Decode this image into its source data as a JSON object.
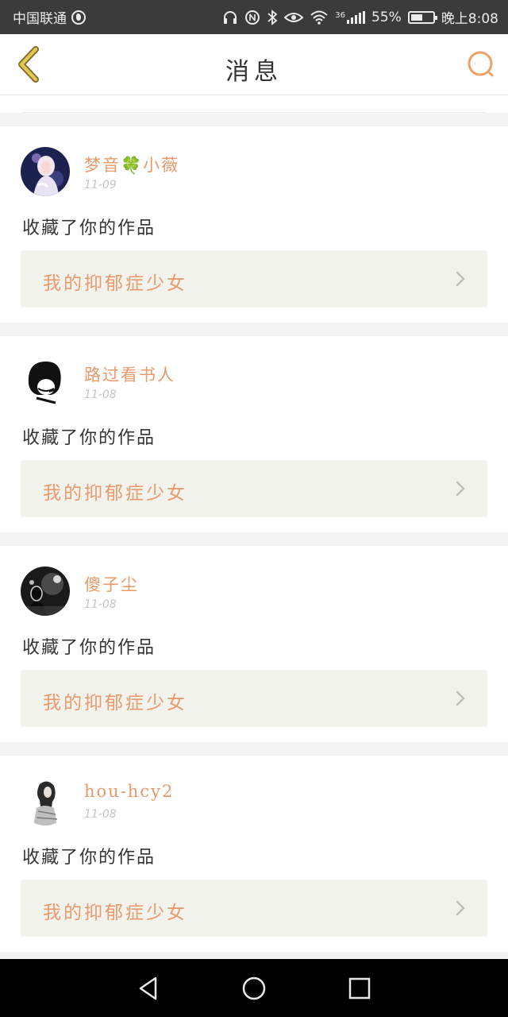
{
  "status_bar": {
    "carrier": "中国联通",
    "network": "36",
    "battery": "55%",
    "battery_level": 0.55,
    "time": "晚上8:08",
    "icons": [
      "globe-icon",
      "headphones-icon",
      "nfc-icon",
      "bluetooth-icon",
      "eye-icon",
      "wifi-icon",
      "signal-icon",
      "battery-icon"
    ]
  },
  "header": {
    "title": "消息",
    "back_icon": "chevron-left-icon",
    "search_icon": "search-icon"
  },
  "colors": {
    "accent": "#e79a6b",
    "back_icon": "#d8b84a",
    "search_icon": "#f0a266"
  },
  "messages": [
    {
      "user": "梦音🍀小薇",
      "date": "11-09",
      "action": "收藏了你的作品",
      "work_title": "我的抑郁症少女",
      "avatar": "avatar-girl-icon"
    },
    {
      "user": "路过看书人",
      "date": "11-08",
      "action": "收藏了你的作品",
      "work_title": "我的抑郁症少女",
      "avatar": "avatar-drawing-icon"
    },
    {
      "user": "傻子尘",
      "date": "11-08",
      "action": "收藏了你的作品",
      "work_title": "我的抑郁症少女",
      "avatar": "avatar-night-icon"
    },
    {
      "user": "hou-hcy2",
      "date": "11-08",
      "action": "收藏了你的作品",
      "work_title": "我的抑郁症少女",
      "avatar": "avatar-sketch-icon"
    }
  ],
  "nav_bar": {
    "icons": [
      "back-triangle-icon",
      "home-circle-icon",
      "recents-square-icon"
    ]
  }
}
